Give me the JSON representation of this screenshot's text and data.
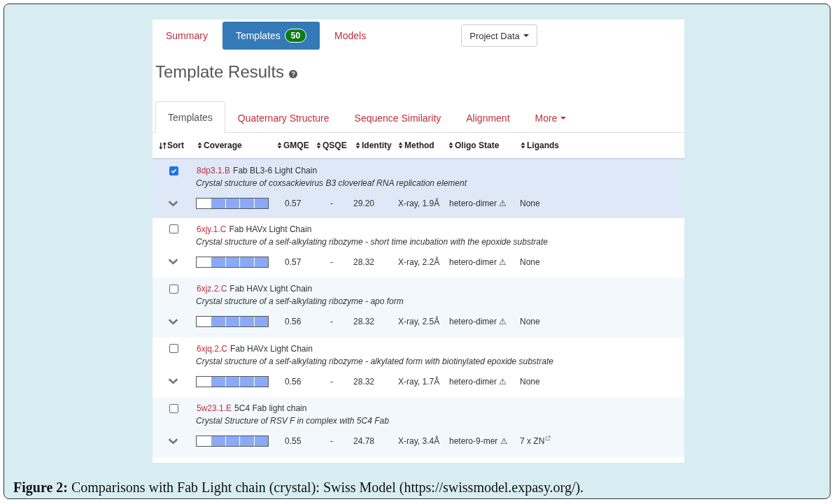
{
  "nav": [
    {
      "label": "Summary",
      "selected": false
    },
    {
      "label": "Templates",
      "badge": "50",
      "selected": true
    },
    {
      "label": "Models",
      "selected": false
    }
  ],
  "project_data_button": "Project Data",
  "heading": "Template Results",
  "tabs": [
    {
      "label": "Templates",
      "selected": true,
      "dropdown": false
    },
    {
      "label": "Quaternary Structure",
      "selected": false,
      "dropdown": false
    },
    {
      "label": "Sequence Similarity",
      "selected": false,
      "dropdown": false
    },
    {
      "label": "Alignment",
      "selected": false,
      "dropdown": false
    },
    {
      "label": "More",
      "selected": false,
      "dropdown": true
    }
  ],
  "table": {
    "sort_label": "Sort",
    "columns": [
      "Coverage",
      "GMQE",
      "QSQE",
      "Identity",
      "Method",
      "Oligo State",
      "Ligands"
    ],
    "rows": [
      {
        "checked": true,
        "id": "8dp3.1.B",
        "name": "Fab BL3-6 Light Chain",
        "description": "Crystal structure of coxsackievirus B3 cloverleaf RNA replication element",
        "level": 0.79,
        "gmqe": "0.57",
        "qsqe": "-",
        "identity": "29.20",
        "method": "X-ray, 1.9Å",
        "oligo_state": "hetero-dimer ⚠",
        "ligands": "None",
        "ligand_link": false
      },
      {
        "checked": false,
        "id": "6xjy.1.C",
        "name": "Fab HAVx Light Chain",
        "description": "Crystal structure of a self-alkylating ribozyme - short time incubation with the epoxide substrate",
        "level": 0.79,
        "gmqe": "0.57",
        "qsqe": "-",
        "identity": "28.32",
        "method": "X-ray, 2.2Å",
        "oligo_state": "hetero-dimer ⚠",
        "ligands": "None",
        "ligand_link": false
      },
      {
        "checked": false,
        "id": "6xjz.2.C",
        "name": "Fab HAVx Light Chain",
        "description": "Crystal structure of a self-alkylating ribozyme - apo form",
        "level": 0.79,
        "gmqe": "0.56",
        "qsqe": "-",
        "identity": "28.32",
        "method": "X-ray, 2.5Å",
        "oligo_state": "hetero-dimer ⚠",
        "ligands": "None",
        "ligand_link": false
      },
      {
        "checked": false,
        "id": "6xjq.2.C",
        "name": "Fab HAVx Light Chain",
        "description": "Crystal structure of a self-alkylating ribozyme - alkylated form with biotinylated epoxide substrate",
        "level": 0.79,
        "gmqe": "0.56",
        "qsqe": "-",
        "identity": "28.32",
        "method": "X-ray, 1.7Å",
        "oligo_state": "hetero-dimer ⚠",
        "ligands": "None",
        "ligand_link": false
      },
      {
        "checked": false,
        "id": "5w23.1.E",
        "name": "5C4 Fab light chain",
        "description": "Crystal Structure of RSV F in complex with 5C4 Fab",
        "level": 0.79,
        "gmqe": "0.55",
        "qsqe": "-",
        "identity": "24.78",
        "method": "X-ray, 3.4Å",
        "oligo_state": "hetero-9-mer ⚠",
        "ligands": "7 x ZN",
        "ligand_link": true
      }
    ]
  },
  "caption": "**Figure 2:** Comparisons with Fab Light chain (crystal): Swiss Model (https://swissmodel.expasy.org/)."
}
